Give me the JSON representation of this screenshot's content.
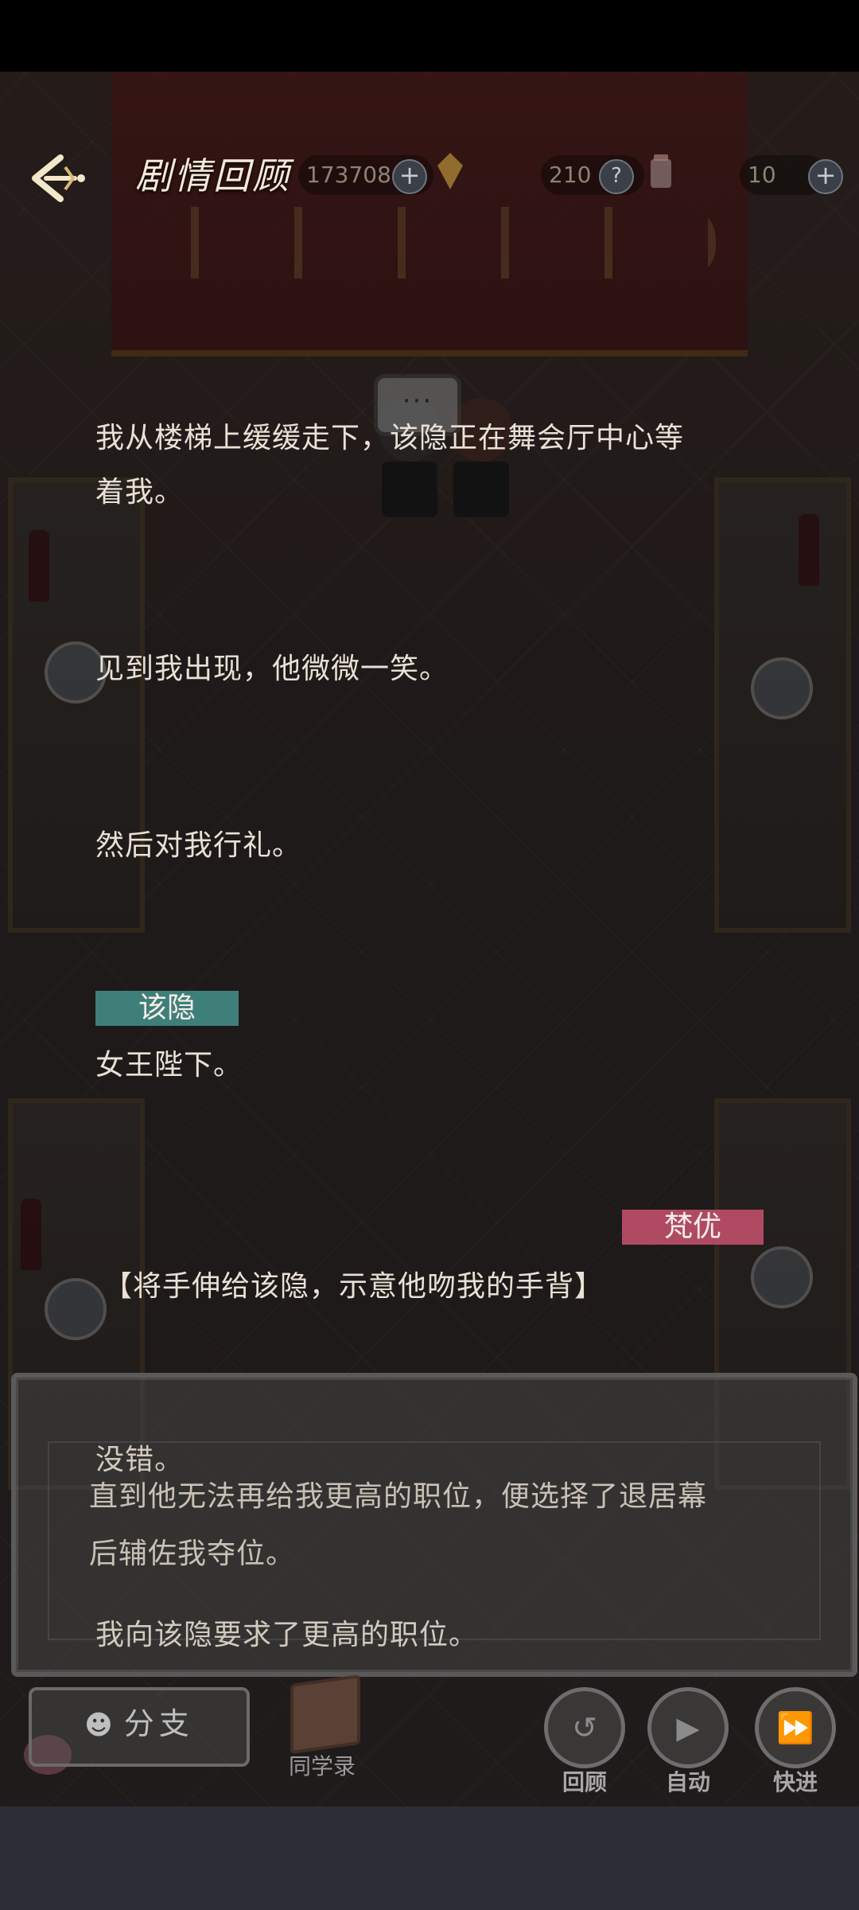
{
  "header": {
    "title": "剧情回顾",
    "resources": [
      {
        "value": "173708",
        "icon": "gem-icon"
      },
      {
        "value": "210",
        "icon": "cup-icon"
      },
      {
        "value": "10",
        "icon": "ticket-icon"
      }
    ],
    "plus": "+",
    "help": "?"
  },
  "scene": {
    "bubble": "···"
  },
  "story": {
    "lines": [
      "我从楼梯上缓缓走下，该隐正在舞会厅中心等",
      "着我。",
      "见到我出现，他微微一笑。",
      "然后对我行礼。"
    ],
    "speaker1": "该隐",
    "line5": "女王陛下。",
    "speaker2": "梵优",
    "line6": "【将手伸给该隐，示意他吻我的手背】"
  },
  "dialogue": {
    "line_top": "没错。",
    "line_a": "直到他无法再给我更高的职位，便选择了退居幕",
    "line_b": "后辅佐我夺位。",
    "line_c": "我向该隐要求了更高的职位。"
  },
  "controls": {
    "branch": "分支",
    "roster": "同学录",
    "review": "回顾",
    "auto": "自动",
    "fast": "快进"
  },
  "colors": {
    "speaker1_bg": "#3f7f7a",
    "speaker2_bg": "#b04a62"
  }
}
